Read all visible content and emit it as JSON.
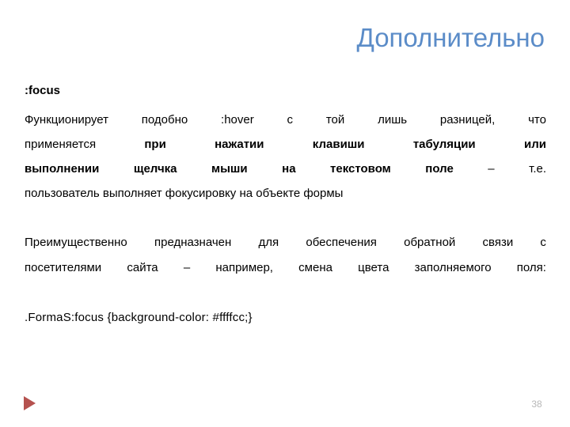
{
  "slide": {
    "title": "Дополнительно",
    "title_color": "#5b8cc8",
    "background_color": "#ffffff"
  },
  "content": {
    "heading": ":focus",
    "paragraph1": {
      "lines": [
        {
          "justified": true,
          "segments": [
            {
              "text": "Функционирует",
              "bold": false
            },
            {
              "text": "подобно",
              "bold": false
            },
            {
              "text": ":hover",
              "bold": false
            },
            {
              "text": "с",
              "bold": false
            },
            {
              "text": "той",
              "bold": false
            },
            {
              "text": "лишь",
              "bold": false
            },
            {
              "text": "разницей,",
              "bold": false
            },
            {
              "text": "что",
              "bold": false
            }
          ]
        },
        {
          "justified": true,
          "segments": [
            {
              "text": "применяется",
              "bold": false
            },
            {
              "text": "при",
              "bold": true
            },
            {
              "text": "нажатии",
              "bold": true
            },
            {
              "text": "клавиши",
              "bold": true
            },
            {
              "text": "табуляции",
              "bold": true
            },
            {
              "text": "или",
              "bold": true
            }
          ]
        },
        {
          "justified": true,
          "segments": [
            {
              "text": "выполнении",
              "bold": true
            },
            {
              "text": "щелчка",
              "bold": true
            },
            {
              "text": "мыши",
              "bold": true
            },
            {
              "text": "на",
              "bold": true
            },
            {
              "text": "текстовом",
              "bold": true
            },
            {
              "text": "поле",
              "bold": true
            },
            {
              "text": "–",
              "bold": false
            },
            {
              "text": "т.е.",
              "bold": false
            }
          ]
        },
        {
          "justified": false,
          "segments": [
            {
              "text": "пользователь выполняет фокусировку на объекте формы",
              "bold": false
            }
          ]
        }
      ],
      "plain_text": "Функционирует подобно :hover с той лишь разницей, что применяется при нажатии клавиши табуляции или выполнении щелчка мыши на текстовом поле – т.е. пользователь выполняет фокусировку на объекте формы"
    },
    "paragraph2": {
      "lines": [
        {
          "justified": true,
          "segments": [
            {
              "text": "Преимущественно",
              "bold": false
            },
            {
              "text": "предназначен",
              "bold": false
            },
            {
              "text": "для",
              "bold": false
            },
            {
              "text": "обеспечения",
              "bold": false
            },
            {
              "text": "обратной",
              "bold": false
            },
            {
              "text": "связи",
              "bold": false
            },
            {
              "text": "с",
              "bold": false
            }
          ]
        },
        {
          "justified": true,
          "segments": [
            {
              "text": "посетителями",
              "bold": false
            },
            {
              "text": "сайта",
              "bold": false
            },
            {
              "text": "–",
              "bold": false
            },
            {
              "text": "например,",
              "bold": false
            },
            {
              "text": "смена",
              "bold": false
            },
            {
              "text": "цвета",
              "bold": false
            },
            {
              "text": "заполняемого",
              "bold": false
            },
            {
              "text": "поля:",
              "bold": false
            }
          ]
        }
      ],
      "plain_text": "Преимущественно предназначен для обеспечения обратной связи с посетителями сайта – например, смена цвета заполняемого поля:"
    },
    "code_example": ".FormaS:focus {background-color: #ffffcc;}"
  },
  "footer": {
    "marker_icon": "play-triangle-icon",
    "marker_color": "#b5524f",
    "page_number": "38",
    "page_number_color": "#b8b8b8"
  }
}
